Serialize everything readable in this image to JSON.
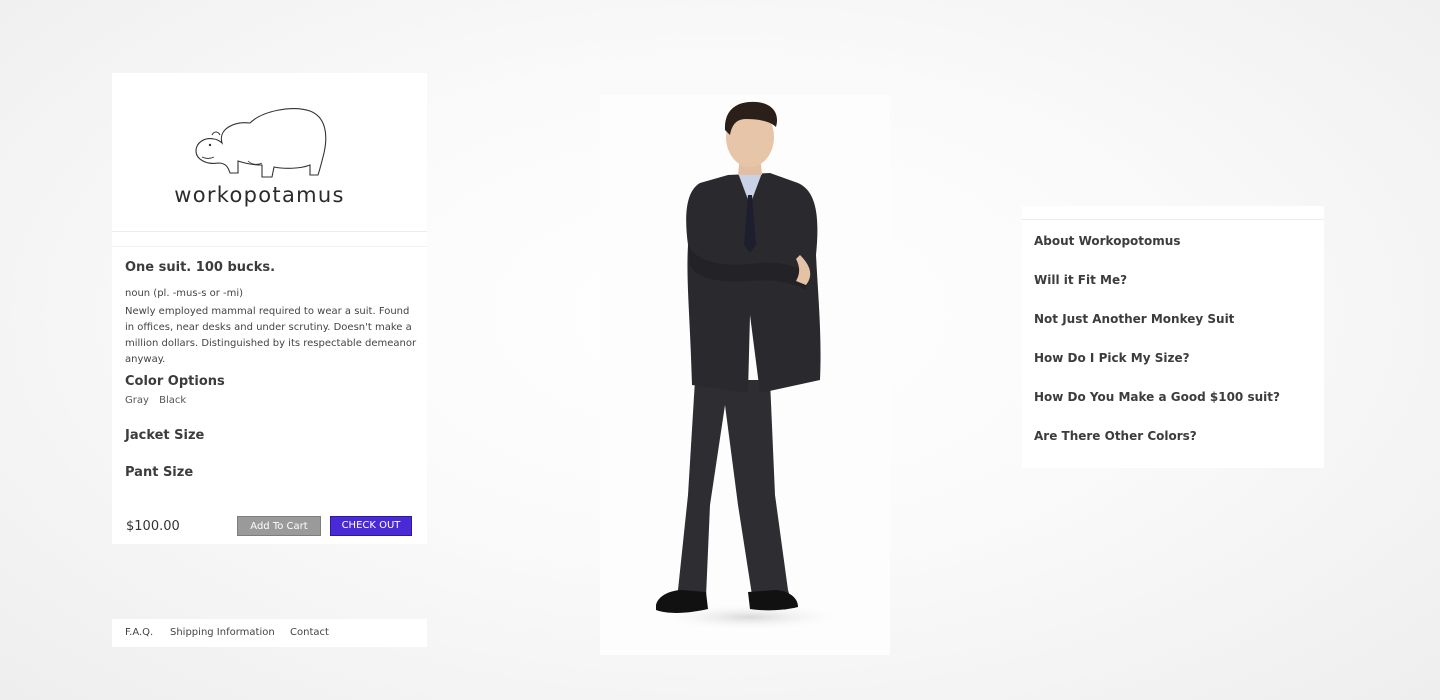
{
  "brand": {
    "name": "workopotamus",
    "logo_icon": "hippo-icon"
  },
  "product": {
    "tagline": "One suit. 100 bucks.",
    "noun": "noun (pl. -mus-s or -mi)",
    "description": "Newly employed mammal required to wear a suit. Found in offices, near desks and under scrutiny. Doesn't make a million dollars. Distinguished by its respectable demeanor anyway.",
    "color_heading": "Color Options",
    "colors": [
      "Gray",
      "Black"
    ],
    "jacket_heading": "Jacket Size",
    "pant_heading": "Pant Size",
    "price": "$100.00",
    "add_to_cart": "Add To Cart",
    "checkout": "CHECK OUT"
  },
  "footer": {
    "faq": "F.A.Q.",
    "shipping": "Shipping Information",
    "contact": "Contact"
  },
  "faq_links": [
    "About Workopotomus",
    "Will it Fit Me?",
    "Not Just Another Monkey Suit",
    "How Do I Pick My Size?",
    "How Do You Make a Good $100 suit?",
    "Are There Other Colors?"
  ],
  "colors": {
    "checkout": "#4a2ad4",
    "cart_button": "#9a9a9a"
  }
}
